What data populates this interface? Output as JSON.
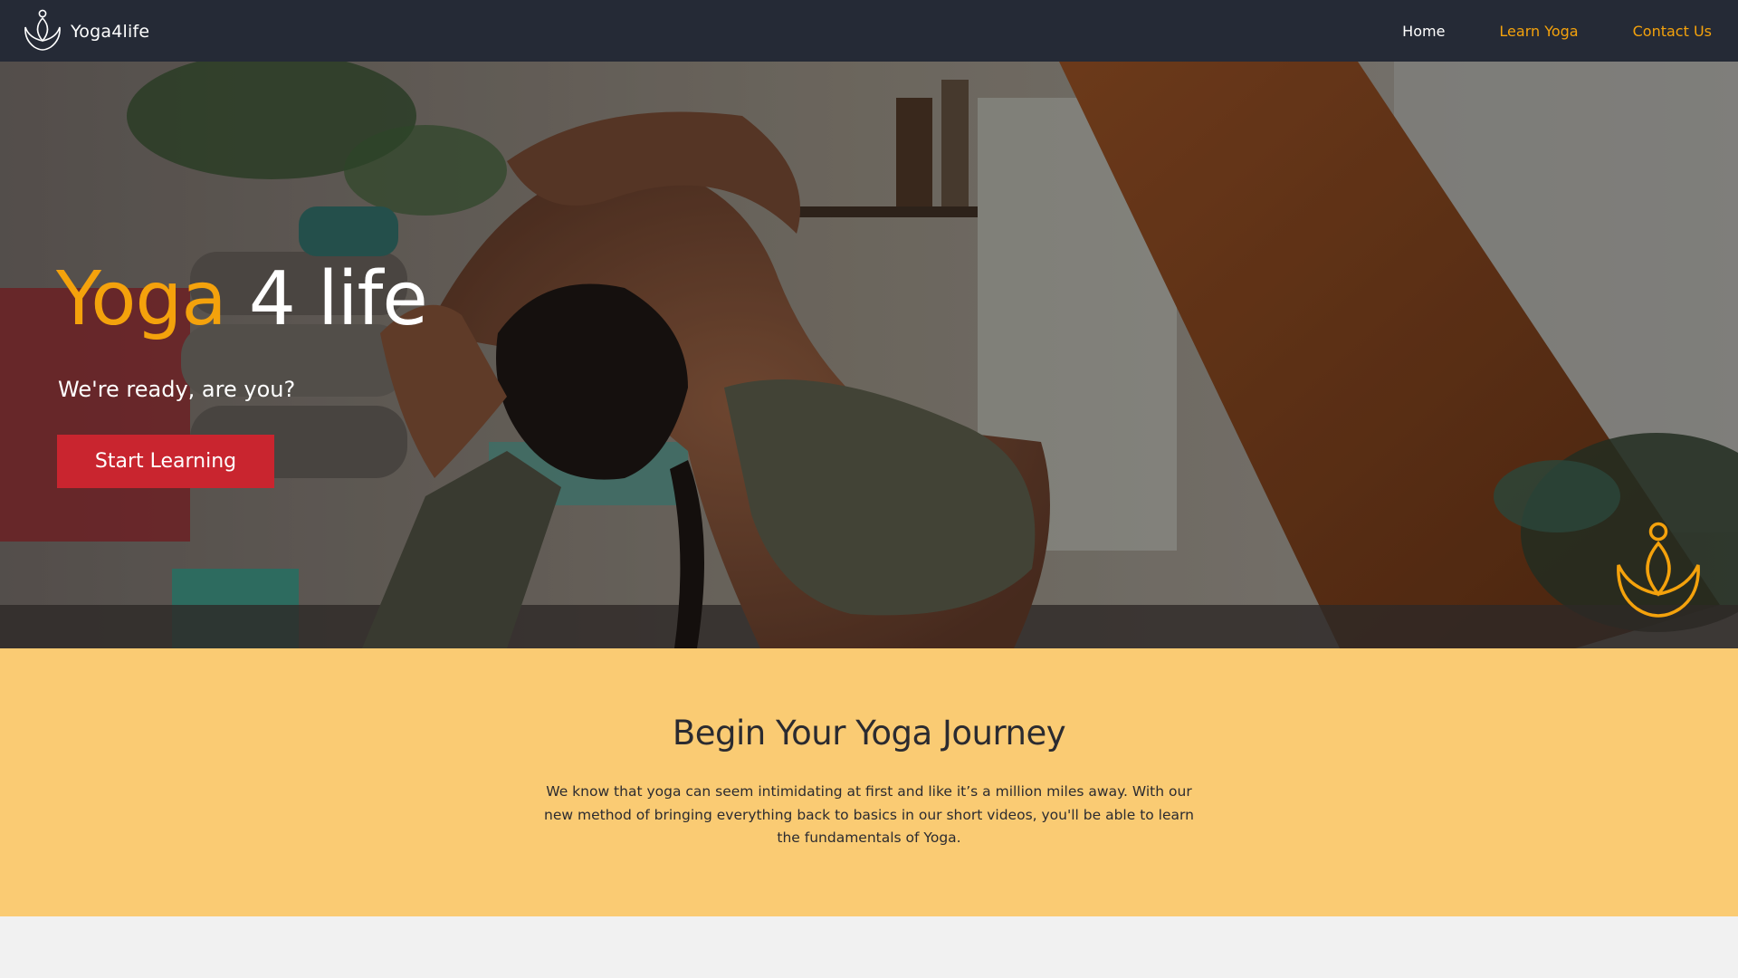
{
  "colors": {
    "navbar_bg": "#252a36",
    "accent": "#f4a20c",
    "button_bg": "#c9252f",
    "journey_bg": "#facb73",
    "page_bg": "#f1f1f1"
  },
  "navbar": {
    "logo_icon": "meditation-lotus-icon",
    "brand_name": "Yoga4life",
    "links": [
      {
        "label": "Home"
      },
      {
        "label": "Learn Yoga"
      },
      {
        "label": "Contact Us"
      }
    ]
  },
  "hero": {
    "title_accent": "Yoga",
    "title_rest": "4 life",
    "subtitle": "We're ready, are you?",
    "cta_label": "Start Learning",
    "emblem_icon": "meditation-lotus-icon",
    "background": "woman-doing-yoga-backbend-photo"
  },
  "journey": {
    "title": "Begin Your Yoga Journey",
    "text": "We know that yoga can seem intimidating at first and like it’s a million miles away. With our new method of bringing everything back to basics in our short videos, you'll be able to learn the fundamentals of Yoga."
  }
}
